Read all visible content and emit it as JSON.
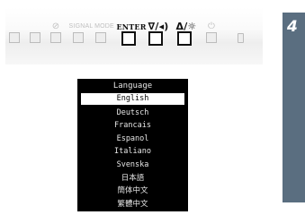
{
  "control_panel": {
    "labels": {
      "eco": "🔍",
      "signal": "SIGNAL",
      "mode": "MODE",
      "enter": "ENTER",
      "down_volume": "∇/◂)",
      "up_brightness": "Δ/☼",
      "power": "⏻"
    },
    "highlighted_buttons": [
      "enter",
      "down_volume",
      "up_brightness"
    ]
  },
  "step": {
    "number": "4",
    "color": "#5a6e80"
  },
  "menu": {
    "title": "Language",
    "items": [
      "English",
      "Deutsch",
      "Francais",
      "Espanol",
      "Italiano",
      "Svenska",
      "日本語",
      "簡体中文",
      "繁體中文"
    ],
    "selected": "English"
  }
}
